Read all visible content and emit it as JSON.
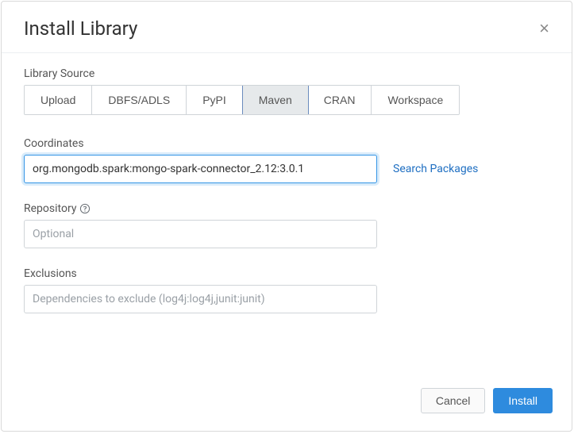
{
  "header": {
    "title": "Install Library",
    "close_label": "×"
  },
  "source": {
    "label": "Library Source",
    "tabs": [
      {
        "label": "Upload"
      },
      {
        "label": "DBFS/ADLS"
      },
      {
        "label": "PyPI"
      },
      {
        "label": "Maven"
      },
      {
        "label": "CRAN"
      },
      {
        "label": "Workspace"
      }
    ],
    "active_index": 3
  },
  "coordinates": {
    "label": "Coordinates",
    "value": "org.mongodb.spark:mongo-spark-connector_2.12:3.0.1",
    "search_label": "Search Packages"
  },
  "repository": {
    "label": "Repository",
    "placeholder": "Optional",
    "value": ""
  },
  "exclusions": {
    "label": "Exclusions",
    "placeholder": "Dependencies to exclude (log4j:log4j,junit:junit)",
    "value": ""
  },
  "footer": {
    "cancel": "Cancel",
    "install": "Install"
  }
}
